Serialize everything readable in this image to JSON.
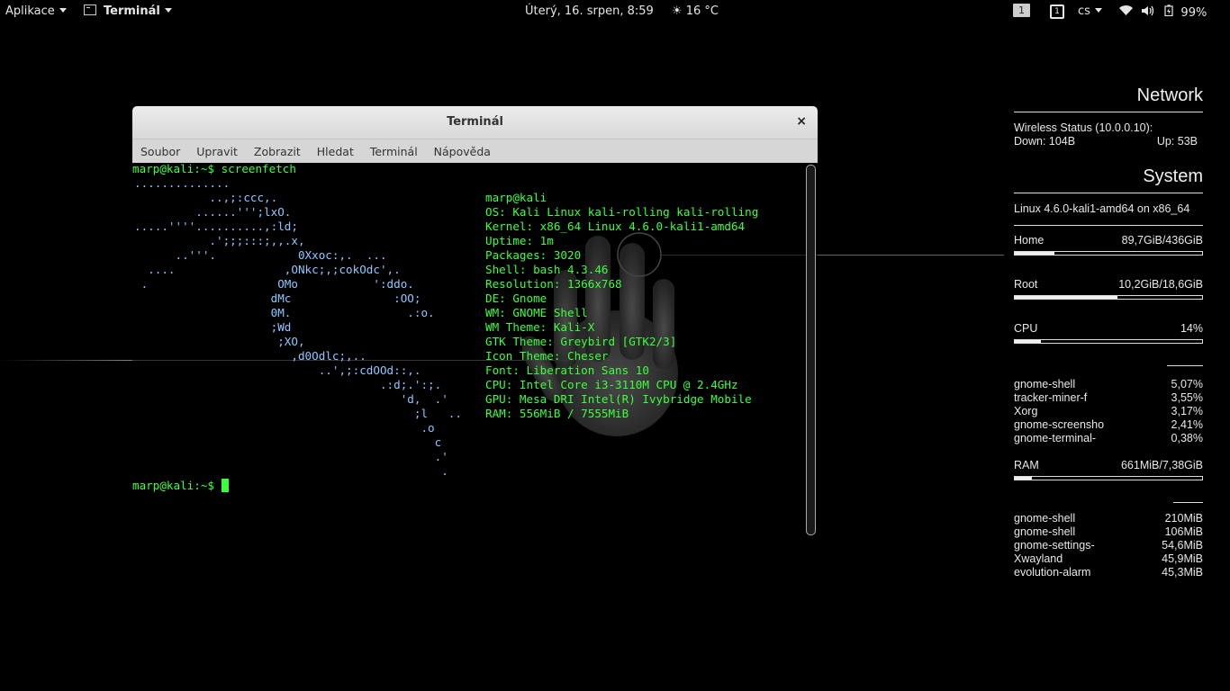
{
  "topbar": {
    "applications": "Aplikace",
    "app_name": "Terminál",
    "datetime": "Úterý, 16. srpen,   8:59",
    "temperature": "16 °C",
    "workspace": "1",
    "workspace_icon": "1",
    "language": "cs",
    "battery": "99%"
  },
  "window": {
    "title": "Terminál",
    "close": "×",
    "menu": [
      "Soubor",
      "Upravit",
      "Zobrazit",
      "Hledat",
      "Terminál",
      "Nápověda"
    ]
  },
  "terminal": {
    "prompt1": "marp@kali:~$ screenfetch",
    "prompt2": "marp@kali:~$ ",
    "logo": [
      "..............",
      "           ..,;:ccc,.",
      "         ......''';lxO.",
      ".....''''..........,:ld;",
      "           .';;;:::;,,.x,",
      "      ..'''.            0Xxoc:,.  ...",
      "  ....                ,ONkc;,;cokOdc',.",
      " .                   OMo           ':ddo.",
      "                    dMc               :OO;",
      "                    0M.                 .:o.",
      "                    ;Wd",
      "                     ;XO,",
      "                       ,d0Odlc;,..",
      "                           ..',;:cdOOd::,.",
      "                                    .:d;.':;.",
      "                                       'd,  .'",
      "                                         ;l   ..",
      "                                          .o",
      "                                            c",
      "                                            .'",
      "                                             ."
    ],
    "info": [
      "marp@kali",
      "OS: Kali Linux kali-rolling kali-rolling",
      "Kernel: x86_64 Linux 4.6.0-kali1-amd64",
      "Uptime: 1m",
      "Packages: 3020",
      "Shell: bash 4.3.46",
      "Resolution: 1366x768",
      "DE: Gnome",
      "WM: GNOME Shell",
      "WM Theme: Kali-X",
      "GTK Theme: Greybird [GTK2/3]",
      "Icon Theme: Cheser",
      "Font: Liberation Sans 10",
      "CPU: Intel Core i3-3110M CPU @ 2.4GHz",
      "GPU: Mesa DRI Intel(R) Ivybridge Mobile",
      "RAM: 556MiB / 7555MiB"
    ]
  },
  "conky": {
    "network_title": "Network",
    "wireless": "Wireless Status (10.0.0.10):",
    "down": "Down: 104B",
    "up": "Up: 53B",
    "system_title": "System",
    "kernel": "Linux 4.6.0-kali1-amd64 on x86_64",
    "home_label": "Home",
    "home_value": "89,7GiB/436GiB",
    "home_frac": 0.21,
    "root_label": "Root",
    "root_value": "10,2GiB/18,6GiB",
    "root_frac": 0.55,
    "cpu_label": "CPU",
    "cpu_value": "14%",
    "cpu_frac": 0.14,
    "cpu_procs": [
      {
        "name": "gnome-shell",
        "value": "5,07%"
      },
      {
        "name": "tracker-miner-f",
        "value": "3,55%"
      },
      {
        "name": "Xorg",
        "value": "3,17%"
      },
      {
        "name": "gnome-screensho",
        "value": "2,41%"
      },
      {
        "name": "gnome-terminal-",
        "value": "0,38%"
      }
    ],
    "ram_label": "RAM",
    "ram_value": "661MiB/7,38GiB",
    "ram_frac": 0.09,
    "ram_procs": [
      {
        "name": "gnome-shell",
        "value": "210MiB"
      },
      {
        "name": "gnome-shell",
        "value": "106MiB"
      },
      {
        "name": "gnome-settings-",
        "value": "54,6MiB"
      },
      {
        "name": "Xwayland",
        "value": "45,9MiB"
      },
      {
        "name": "evolution-alarm",
        "value": "45,3MiB"
      }
    ]
  }
}
